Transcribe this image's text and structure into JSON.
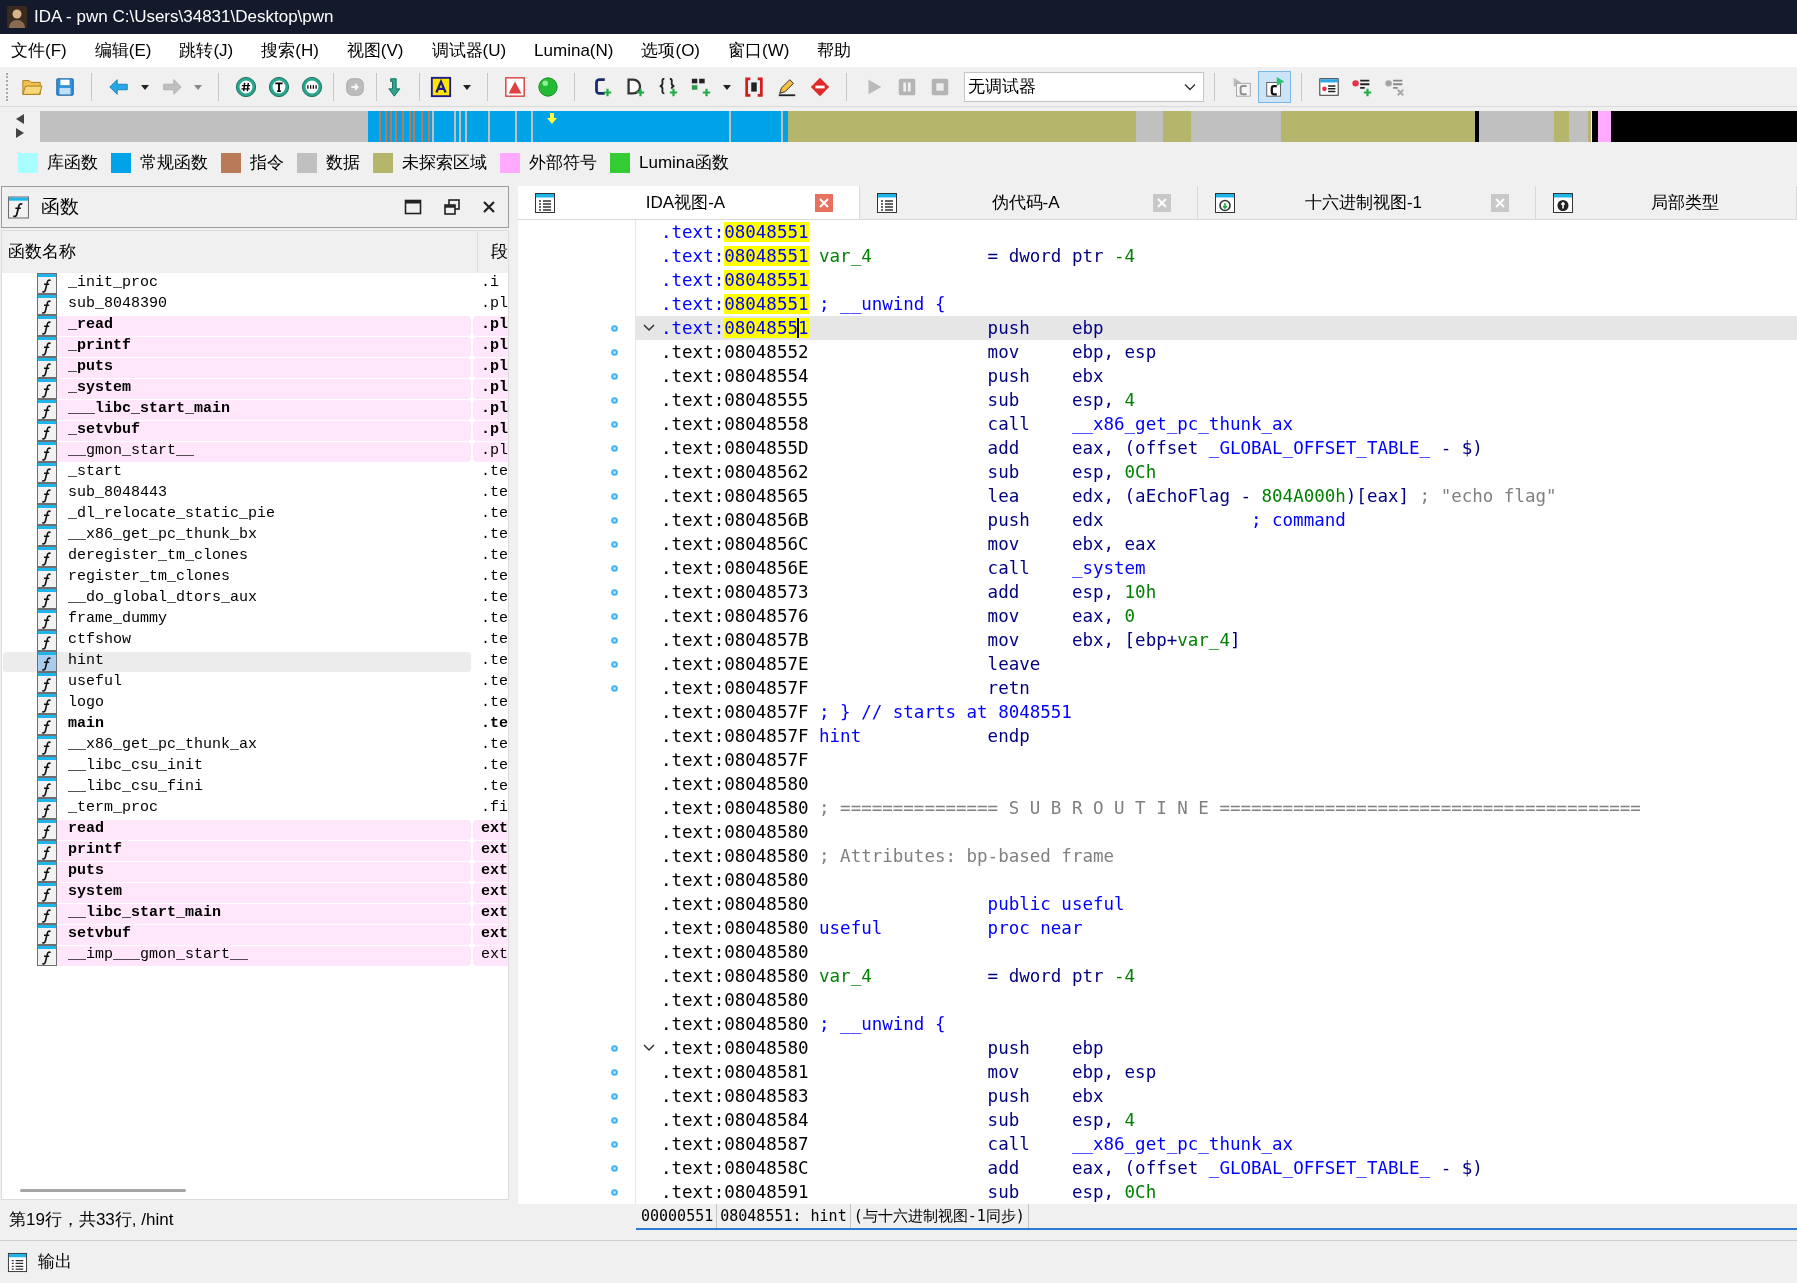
{
  "window": {
    "title": "IDA - pwn C:\\Users\\34831\\Desktop\\pwn"
  },
  "menu": [
    "文件(F)",
    "编辑(E)",
    "跳转(J)",
    "搜索(H)",
    "视图(V)",
    "调试器(U)",
    "Lumina(N)",
    "选项(O)",
    "窗口(W)",
    "帮助"
  ],
  "toolbar": [
    {
      "items": [
        {
          "kind": "open",
          "disabled": false,
          "pressed": false
        },
        {
          "kind": "save",
          "disabled": false,
          "pressed": false
        }
      ]
    },
    {
      "items": [
        {
          "kind": "back",
          "disabled": false,
          "pressed": false
        },
        {
          "kind": "caret",
          "disabled": false,
          "pressed": false
        },
        {
          "kind": "forward",
          "disabled": true,
          "pressed": false
        },
        {
          "kind": "caret",
          "disabled": true,
          "pressed": false
        }
      ]
    },
    {
      "items": [
        {
          "kind": "hex",
          "disabled": false,
          "pressed": false
        },
        {
          "kind": "text",
          "disabled": false,
          "pressed": false
        },
        {
          "kind": "binary",
          "disabled": false,
          "pressed": false
        }
      ]
    },
    {
      "items": [
        {
          "kind": "export",
          "disabled": true,
          "pressed": false
        }
      ]
    },
    {
      "items": [
        {
          "kind": "jump",
          "disabled": false,
          "pressed": false
        }
      ]
    },
    {
      "items": [
        {
          "kind": "letter",
          "disabled": false,
          "pressed": false
        },
        {
          "kind": "caret",
          "disabled": false,
          "pressed": false
        }
      ]
    },
    {
      "items": [
        {
          "kind": "flag",
          "disabled": false,
          "pressed": false
        },
        {
          "kind": "ball",
          "disabled": false,
          "pressed": false
        }
      ]
    },
    {
      "items": [
        {
          "kind": "code",
          "disabled": false,
          "pressed": false
        },
        {
          "kind": "data",
          "disabled": false,
          "pressed": false
        },
        {
          "kind": "braces",
          "disabled": false,
          "pressed": false
        },
        {
          "kind": "struct",
          "disabled": false,
          "pressed": false
        },
        {
          "kind": "caret",
          "disabled": false,
          "pressed": false
        },
        {
          "kind": "array",
          "disabled": false,
          "pressed": false
        },
        {
          "kind": "pencil",
          "disabled": false,
          "pressed": false
        },
        {
          "kind": "stop",
          "disabled": false,
          "pressed": false
        }
      ]
    },
    {
      "items": [
        {
          "kind": "play",
          "disabled": true,
          "pressed": false
        },
        {
          "kind": "pause",
          "disabled": true,
          "pressed": false
        },
        {
          "kind": "halt",
          "disabled": true,
          "pressed": false
        },
        {
          "kind": "select",
          "value": "无调试器",
          "disabled": false,
          "pressed": false
        }
      ]
    },
    {
      "items": [
        {
          "kind": "runc",
          "disabled": true,
          "pressed": false
        },
        {
          "kind": "ctoggle",
          "disabled": false,
          "pressed": true
        }
      ]
    },
    {
      "items": [
        {
          "kind": "bplist",
          "disabled": false,
          "pressed": false
        },
        {
          "kind": "bpadd",
          "disabled": false,
          "pressed": false
        },
        {
          "kind": "bpremove",
          "disabled": true,
          "pressed": false
        }
      ]
    }
  ],
  "legend": [
    {
      "label": "库函数",
      "color": "#a9ffff"
    },
    {
      "label": "常规函数",
      "color": "#00a2e8"
    },
    {
      "label": "指令",
      "color": "#b97a57"
    },
    {
      "label": "数据",
      "color": "#c0c0c0"
    },
    {
      "label": "未探索区域",
      "color": "#b5b56b"
    },
    {
      "label": "外部符号",
      "color": "#ffaaff"
    },
    {
      "label": "Lumina函数",
      "color": "#33cc33"
    }
  ],
  "functions_panel": {
    "title": "函数",
    "columns": [
      "函数名称",
      "段"
    ],
    "rows": [
      {
        "name": "_init_proc",
        "segment": ".i",
        "external": false,
        "bold": false,
        "selected": false
      },
      {
        "name": "sub_8048390",
        "segment": ".pl",
        "external": false,
        "bold": false,
        "selected": false
      },
      {
        "name": "_read",
        "segment": ".pl",
        "external": true,
        "bold": true,
        "selected": false
      },
      {
        "name": "_printf",
        "segment": ".pl",
        "external": true,
        "bold": true,
        "selected": false
      },
      {
        "name": "_puts",
        "segment": ".pl",
        "external": true,
        "bold": true,
        "selected": false
      },
      {
        "name": "_system",
        "segment": ".pl",
        "external": true,
        "bold": true,
        "selected": false
      },
      {
        "name": "___libc_start_main",
        "segment": ".pl",
        "external": true,
        "bold": true,
        "selected": false
      },
      {
        "name": "_setvbuf",
        "segment": ".pl",
        "external": true,
        "bold": true,
        "selected": false
      },
      {
        "name": "__gmon_start__",
        "segment": ".pl",
        "external": true,
        "bold": false,
        "selected": false
      },
      {
        "name": "_start",
        "segment": ".te",
        "external": false,
        "bold": false,
        "selected": false
      },
      {
        "name": "sub_8048443",
        "segment": ".te",
        "external": false,
        "bold": false,
        "selected": false
      },
      {
        "name": "_dl_relocate_static_pie",
        "segment": ".te",
        "external": false,
        "bold": false,
        "selected": false
      },
      {
        "name": "__x86_get_pc_thunk_bx",
        "segment": ".te",
        "external": false,
        "bold": false,
        "selected": false
      },
      {
        "name": "deregister_tm_clones",
        "segment": ".te",
        "external": false,
        "bold": false,
        "selected": false
      },
      {
        "name": "register_tm_clones",
        "segment": ".te",
        "external": false,
        "bold": false,
        "selected": false
      },
      {
        "name": "__do_global_dtors_aux",
        "segment": ".te",
        "external": false,
        "bold": false,
        "selected": false
      },
      {
        "name": "frame_dummy",
        "segment": ".te",
        "external": false,
        "bold": false,
        "selected": false
      },
      {
        "name": "ctfshow",
        "segment": ".te",
        "external": false,
        "bold": false,
        "selected": false
      },
      {
        "name": "hint",
        "segment": ".te",
        "external": false,
        "bold": false,
        "selected": true
      },
      {
        "name": "useful",
        "segment": ".te",
        "external": false,
        "bold": false,
        "selected": false
      },
      {
        "name": "logo",
        "segment": ".te",
        "external": false,
        "bold": false,
        "selected": false
      },
      {
        "name": "main",
        "segment": ".te",
        "external": false,
        "bold": true,
        "selected": false
      },
      {
        "name": "__x86_get_pc_thunk_ax",
        "segment": ".te",
        "external": false,
        "bold": false,
        "selected": false
      },
      {
        "name": "__libc_csu_init",
        "segment": ".te",
        "external": false,
        "bold": false,
        "selected": false
      },
      {
        "name": "__libc_csu_fini",
        "segment": ".te",
        "external": false,
        "bold": false,
        "selected": false
      },
      {
        "name": "_term_proc",
        "segment": ".fi",
        "external": false,
        "bold": false,
        "selected": false
      },
      {
        "name": "read",
        "segment": "ext",
        "external": true,
        "bold": true,
        "selected": false
      },
      {
        "name": "printf",
        "segment": "ext",
        "external": true,
        "bold": true,
        "selected": false
      },
      {
        "name": "puts",
        "segment": "ext",
        "external": true,
        "bold": true,
        "selected": false
      },
      {
        "name": "system",
        "segment": "ext",
        "external": true,
        "bold": true,
        "selected": false
      },
      {
        "name": "__libc_start_main",
        "segment": "ext",
        "external": true,
        "bold": true,
        "selected": false
      },
      {
        "name": "setvbuf",
        "segment": "ext",
        "external": true,
        "bold": true,
        "selected": false
      },
      {
        "name": "__imp___gmon_start__",
        "segment": "ext",
        "external": true,
        "bold": false,
        "selected": false
      }
    ],
    "status": "第19行，共33行, /hint"
  },
  "tabs": [
    {
      "label": "IDA视图-A",
      "kind": "disassembly",
      "selected": true,
      "closable": true
    },
    {
      "label": "伪代码-A",
      "kind": "pseudocode",
      "selected": false,
      "closable": true
    },
    {
      "label": "十六进制视图-1",
      "kind": "hex",
      "selected": false,
      "closable": true
    },
    {
      "label": "局部类型",
      "kind": "types",
      "selected": false,
      "closable": false
    }
  ],
  "disassembly": {
    "lines": [
      {
        "address": ".text:08048551",
        "highlight": true,
        "current": false,
        "foldable": false,
        "marker": false
      },
      {
        "address": ".text:08048551",
        "highlight": true,
        "current": false,
        "foldable": false,
        "marker": false,
        "label": [
          {
            "text": "var_4",
            "kind": "var"
          }
        ],
        "op": [
          {
            "text": "= dword ptr ",
            "kind": "insn"
          },
          {
            "text": "-4",
            "kind": "num"
          }
        ]
      },
      {
        "address": ".text:08048551",
        "highlight": true,
        "current": false,
        "foldable": false,
        "marker": false
      },
      {
        "address": ".text:08048551",
        "highlight": true,
        "current": false,
        "foldable": false,
        "marker": false,
        "label": [
          {
            "text": "; __unwind {",
            "kind": "name"
          }
        ]
      },
      {
        "address": ".text:08048551",
        "highlight": true,
        "current": true,
        "foldable": true,
        "marker": true,
        "op": [
          {
            "text": "push",
            "kind": "insn"
          }
        ],
        "args": [
          {
            "text": "ebp",
            "kind": "insn"
          }
        ]
      },
      {
        "address": ".text:08048552",
        "highlight": false,
        "current": false,
        "foldable": false,
        "marker": true,
        "op": [
          {
            "text": "mov",
            "kind": "insn"
          }
        ],
        "args": [
          {
            "text": "ebp, esp",
            "kind": "insn"
          }
        ]
      },
      {
        "address": ".text:08048554",
        "highlight": false,
        "current": false,
        "foldable": false,
        "marker": true,
        "op": [
          {
            "text": "push",
            "kind": "insn"
          }
        ],
        "args": [
          {
            "text": "ebx",
            "kind": "insn"
          }
        ]
      },
      {
        "address": ".text:08048555",
        "highlight": false,
        "current": false,
        "foldable": false,
        "marker": true,
        "op": [
          {
            "text": "sub",
            "kind": "insn"
          }
        ],
        "args": [
          {
            "text": "esp, ",
            "kind": "insn"
          },
          {
            "text": "4",
            "kind": "num"
          }
        ]
      },
      {
        "address": ".text:08048558",
        "highlight": false,
        "current": false,
        "foldable": false,
        "marker": true,
        "op": [
          {
            "text": "call",
            "kind": "insn"
          }
        ],
        "args": [
          {
            "text": "__x86_get_pc_thunk_ax",
            "kind": "name"
          }
        ]
      },
      {
        "address": ".text:0804855D",
        "highlight": false,
        "current": false,
        "foldable": false,
        "marker": true,
        "op": [
          {
            "text": "add",
            "kind": "insn"
          }
        ],
        "args": [
          {
            "text": "eax, (offset ",
            "kind": "insn"
          },
          {
            "text": "_GLOBAL_OFFSET_TABLE_",
            "kind": "name"
          },
          {
            "text": " - $)",
            "kind": "insn"
          }
        ]
      },
      {
        "address": ".text:08048562",
        "highlight": false,
        "current": false,
        "foldable": false,
        "marker": true,
        "op": [
          {
            "text": "sub",
            "kind": "insn"
          }
        ],
        "args": [
          {
            "text": "esp, ",
            "kind": "insn"
          },
          {
            "text": "0Ch",
            "kind": "num"
          }
        ]
      },
      {
        "address": ".text:08048565",
        "highlight": false,
        "current": false,
        "foldable": false,
        "marker": true,
        "op": [
          {
            "text": "lea",
            "kind": "insn"
          }
        ],
        "args": [
          {
            "text": "edx, (aEchoFlag - ",
            "kind": "insn"
          },
          {
            "text": "804A000h",
            "kind": "num"
          },
          {
            "text": ")[eax]",
            "kind": "insn"
          }
        ],
        "comment": [
          {
            "text": "; \"echo flag\"",
            "kind": "note"
          }
        ]
      },
      {
        "address": ".text:0804856B",
        "highlight": false,
        "current": false,
        "foldable": false,
        "marker": true,
        "op": [
          {
            "text": "push",
            "kind": "insn"
          }
        ],
        "args": [
          {
            "text": "edx",
            "kind": "insn"
          }
        ],
        "comment": [
          {
            "text": "; command",
            "kind": "name"
          }
        ]
      },
      {
        "address": ".text:0804856C",
        "highlight": false,
        "current": false,
        "foldable": false,
        "marker": true,
        "op": [
          {
            "text": "mov",
            "kind": "insn"
          }
        ],
        "args": [
          {
            "text": "ebx, eax",
            "kind": "insn"
          }
        ]
      },
      {
        "address": ".text:0804856E",
        "highlight": false,
        "current": false,
        "foldable": false,
        "marker": true,
        "op": [
          {
            "text": "call",
            "kind": "insn"
          }
        ],
        "args": [
          {
            "text": "_system",
            "kind": "name"
          }
        ]
      },
      {
        "address": ".text:08048573",
        "highlight": false,
        "current": false,
        "foldable": false,
        "marker": true,
        "op": [
          {
            "text": "add",
            "kind": "insn"
          }
        ],
        "args": [
          {
            "text": "esp, ",
            "kind": "insn"
          },
          {
            "text": "10h",
            "kind": "num"
          }
        ]
      },
      {
        "address": ".text:08048576",
        "highlight": false,
        "current": false,
        "foldable": false,
        "marker": true,
        "op": [
          {
            "text": "mov",
            "kind": "insn"
          }
        ],
        "args": [
          {
            "text": "eax, ",
            "kind": "insn"
          },
          {
            "text": "0",
            "kind": "num"
          }
        ]
      },
      {
        "address": ".text:0804857B",
        "highlight": false,
        "current": false,
        "foldable": false,
        "marker": true,
        "op": [
          {
            "text": "mov",
            "kind": "insn"
          }
        ],
        "args": [
          {
            "text": "ebx, [ebp+",
            "kind": "insn"
          },
          {
            "text": "var_4",
            "kind": "var"
          },
          {
            "text": "]",
            "kind": "insn"
          }
        ]
      },
      {
        "address": ".text:0804857E",
        "highlight": false,
        "current": false,
        "foldable": false,
        "marker": true,
        "op": [
          {
            "text": "leave",
            "kind": "insn"
          }
        ]
      },
      {
        "address": ".text:0804857F",
        "highlight": false,
        "current": false,
        "foldable": false,
        "marker": true,
        "op": [
          {
            "text": "retn",
            "kind": "insn"
          }
        ]
      },
      {
        "address": ".text:0804857F",
        "highlight": false,
        "current": false,
        "foldable": false,
        "marker": false,
        "label": [
          {
            "text": "; } // starts at 8048551",
            "kind": "name"
          }
        ]
      },
      {
        "address": ".text:0804857F",
        "highlight": false,
        "current": false,
        "foldable": false,
        "marker": false,
        "label": [
          {
            "text": "hint",
            "kind": "name"
          }
        ],
        "op": [
          {
            "text": "endp",
            "kind": "insn"
          }
        ]
      },
      {
        "address": ".text:0804857F",
        "highlight": false,
        "current": false,
        "foldable": false,
        "marker": false
      },
      {
        "address": ".text:08048580",
        "highlight": false,
        "current": false,
        "foldable": false,
        "marker": false
      },
      {
        "address": ".text:08048580",
        "highlight": false,
        "current": false,
        "foldable": false,
        "marker": false,
        "label": [
          {
            "text": "; =============== S U B R O U T I N E ========================================",
            "kind": "note"
          }
        ]
      },
      {
        "address": ".text:08048580",
        "highlight": false,
        "current": false,
        "foldable": false,
        "marker": false
      },
      {
        "address": ".text:08048580",
        "highlight": false,
        "current": false,
        "foldable": false,
        "marker": false,
        "label": [
          {
            "text": "; Attributes: bp-based frame",
            "kind": "note"
          }
        ]
      },
      {
        "address": ".text:08048580",
        "highlight": false,
        "current": false,
        "foldable": false,
        "marker": false
      },
      {
        "address": ".text:08048580",
        "highlight": false,
        "current": false,
        "foldable": false,
        "marker": false,
        "op": [
          {
            "text": "public useful",
            "kind": "name"
          }
        ]
      },
      {
        "address": ".text:08048580",
        "highlight": false,
        "current": false,
        "foldable": false,
        "marker": false,
        "label": [
          {
            "text": "useful",
            "kind": "name"
          }
        ],
        "op": [
          {
            "text": "proc near",
            "kind": "name"
          }
        ]
      },
      {
        "address": ".text:08048580",
        "highlight": false,
        "current": false,
        "foldable": false,
        "marker": false
      },
      {
        "address": ".text:08048580",
        "highlight": false,
        "current": false,
        "foldable": false,
        "marker": false,
        "label": [
          {
            "text": "var_4",
            "kind": "var"
          }
        ],
        "op": [
          {
            "text": "= dword ptr ",
            "kind": "insn"
          },
          {
            "text": "-4",
            "kind": "num"
          }
        ]
      },
      {
        "address": ".text:08048580",
        "highlight": false,
        "current": false,
        "foldable": false,
        "marker": false
      },
      {
        "address": ".text:08048580",
        "highlight": false,
        "current": false,
        "foldable": false,
        "marker": false,
        "label": [
          {
            "text": "; __unwind {",
            "kind": "name"
          }
        ]
      },
      {
        "address": ".text:08048580",
        "highlight": false,
        "current": false,
        "foldable": true,
        "marker": true,
        "op": [
          {
            "text": "push",
            "kind": "insn"
          }
        ],
        "args": [
          {
            "text": "ebp",
            "kind": "insn"
          }
        ]
      },
      {
        "address": ".text:08048581",
        "highlight": false,
        "current": false,
        "foldable": false,
        "marker": true,
        "op": [
          {
            "text": "mov",
            "kind": "insn"
          }
        ],
        "args": [
          {
            "text": "ebp, esp",
            "kind": "insn"
          }
        ]
      },
      {
        "address": ".text:08048583",
        "highlight": false,
        "current": false,
        "foldable": false,
        "marker": true,
        "op": [
          {
            "text": "push",
            "kind": "insn"
          }
        ],
        "args": [
          {
            "text": "ebx",
            "kind": "insn"
          }
        ]
      },
      {
        "address": ".text:08048584",
        "highlight": false,
        "current": false,
        "foldable": false,
        "marker": true,
        "op": [
          {
            "text": "sub",
            "kind": "insn"
          }
        ],
        "args": [
          {
            "text": "esp, ",
            "kind": "insn"
          },
          {
            "text": "4",
            "kind": "num"
          }
        ]
      },
      {
        "address": ".text:08048587",
        "highlight": false,
        "current": false,
        "foldable": false,
        "marker": true,
        "op": [
          {
            "text": "call",
            "kind": "insn"
          }
        ],
        "args": [
          {
            "text": "__x86_get_pc_thunk_ax",
            "kind": "name"
          }
        ]
      },
      {
        "address": ".text:0804858C",
        "highlight": false,
        "current": false,
        "foldable": false,
        "marker": true,
        "op": [
          {
            "text": "add",
            "kind": "insn"
          }
        ],
        "args": [
          {
            "text": "eax, (offset ",
            "kind": "insn"
          },
          {
            "text": "_GLOBAL_OFFSET_TABLE_",
            "kind": "name"
          },
          {
            "text": " - $)",
            "kind": "insn"
          }
        ]
      },
      {
        "address": ".text:08048591",
        "highlight": false,
        "current": false,
        "foldable": false,
        "marker": true,
        "op": [
          {
            "text": "sub",
            "kind": "insn"
          }
        ],
        "args": [
          {
            "text": "esp, ",
            "kind": "insn"
          },
          {
            "text": "0Ch",
            "kind": "num"
          }
        ]
      }
    ],
    "status_bar": [
      "00000551",
      "08048551: hint",
      "(与十六进制视图-1同步)"
    ]
  },
  "output_panel": {
    "title": "输出"
  }
}
